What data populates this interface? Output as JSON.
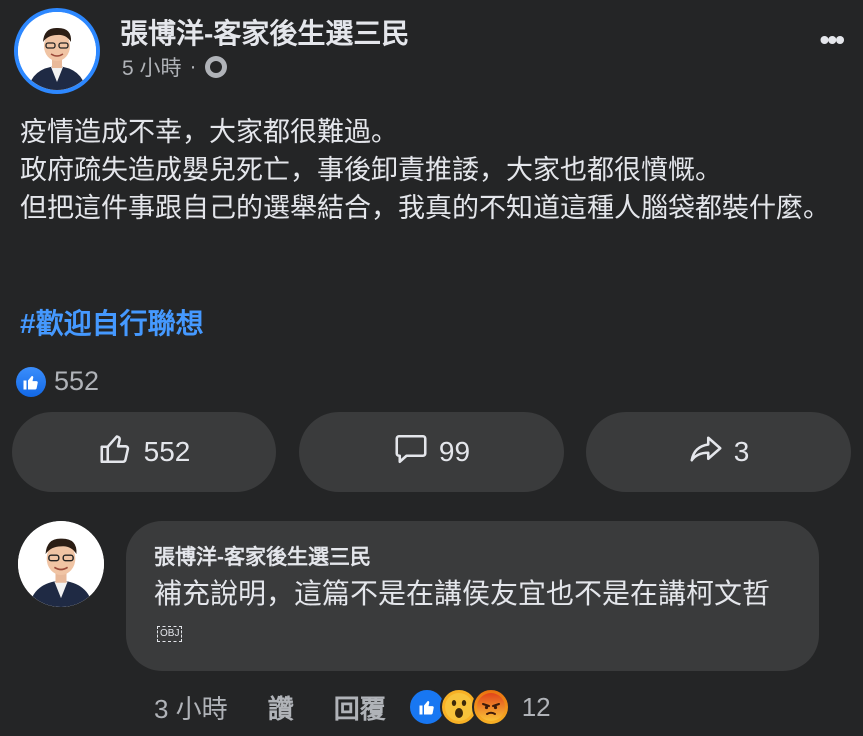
{
  "post": {
    "author": "張博洋-客家後生選三民",
    "time": "5 小時",
    "separator": "·",
    "more_label": "•••",
    "lines": [
      "疫情造成不幸，大家都很難過。",
      "政府疏失造成嬰兒死亡，事後卸責推諉，大家也都很憤慨。",
      "但把這件事跟自己的選舉結合，我真的不知道這種人腦袋都裝什麼。"
    ],
    "hashtag": "#歡迎自行聯想",
    "reaction_count": "552"
  },
  "actions": {
    "like_count": "552",
    "comment_count": "99",
    "share_count": "3"
  },
  "comment": {
    "author": "張博洋-客家後生選三民",
    "text": "補充說明，這篇不是在講侯友宜也不是在講柯文哲",
    "obj_marker": "OBJ",
    "time": "3 小時",
    "like_label": "讚",
    "reply_label": "回覆",
    "reaction_count": "12",
    "reactions": [
      "like",
      "wow",
      "angry"
    ]
  },
  "colors": {
    "background": "#242526",
    "surface": "#3a3b3c",
    "text": "#e4e6eb",
    "secondary_text": "#b0b3b8",
    "hashtag": "#4599ff",
    "accent": "#2d88ff"
  }
}
